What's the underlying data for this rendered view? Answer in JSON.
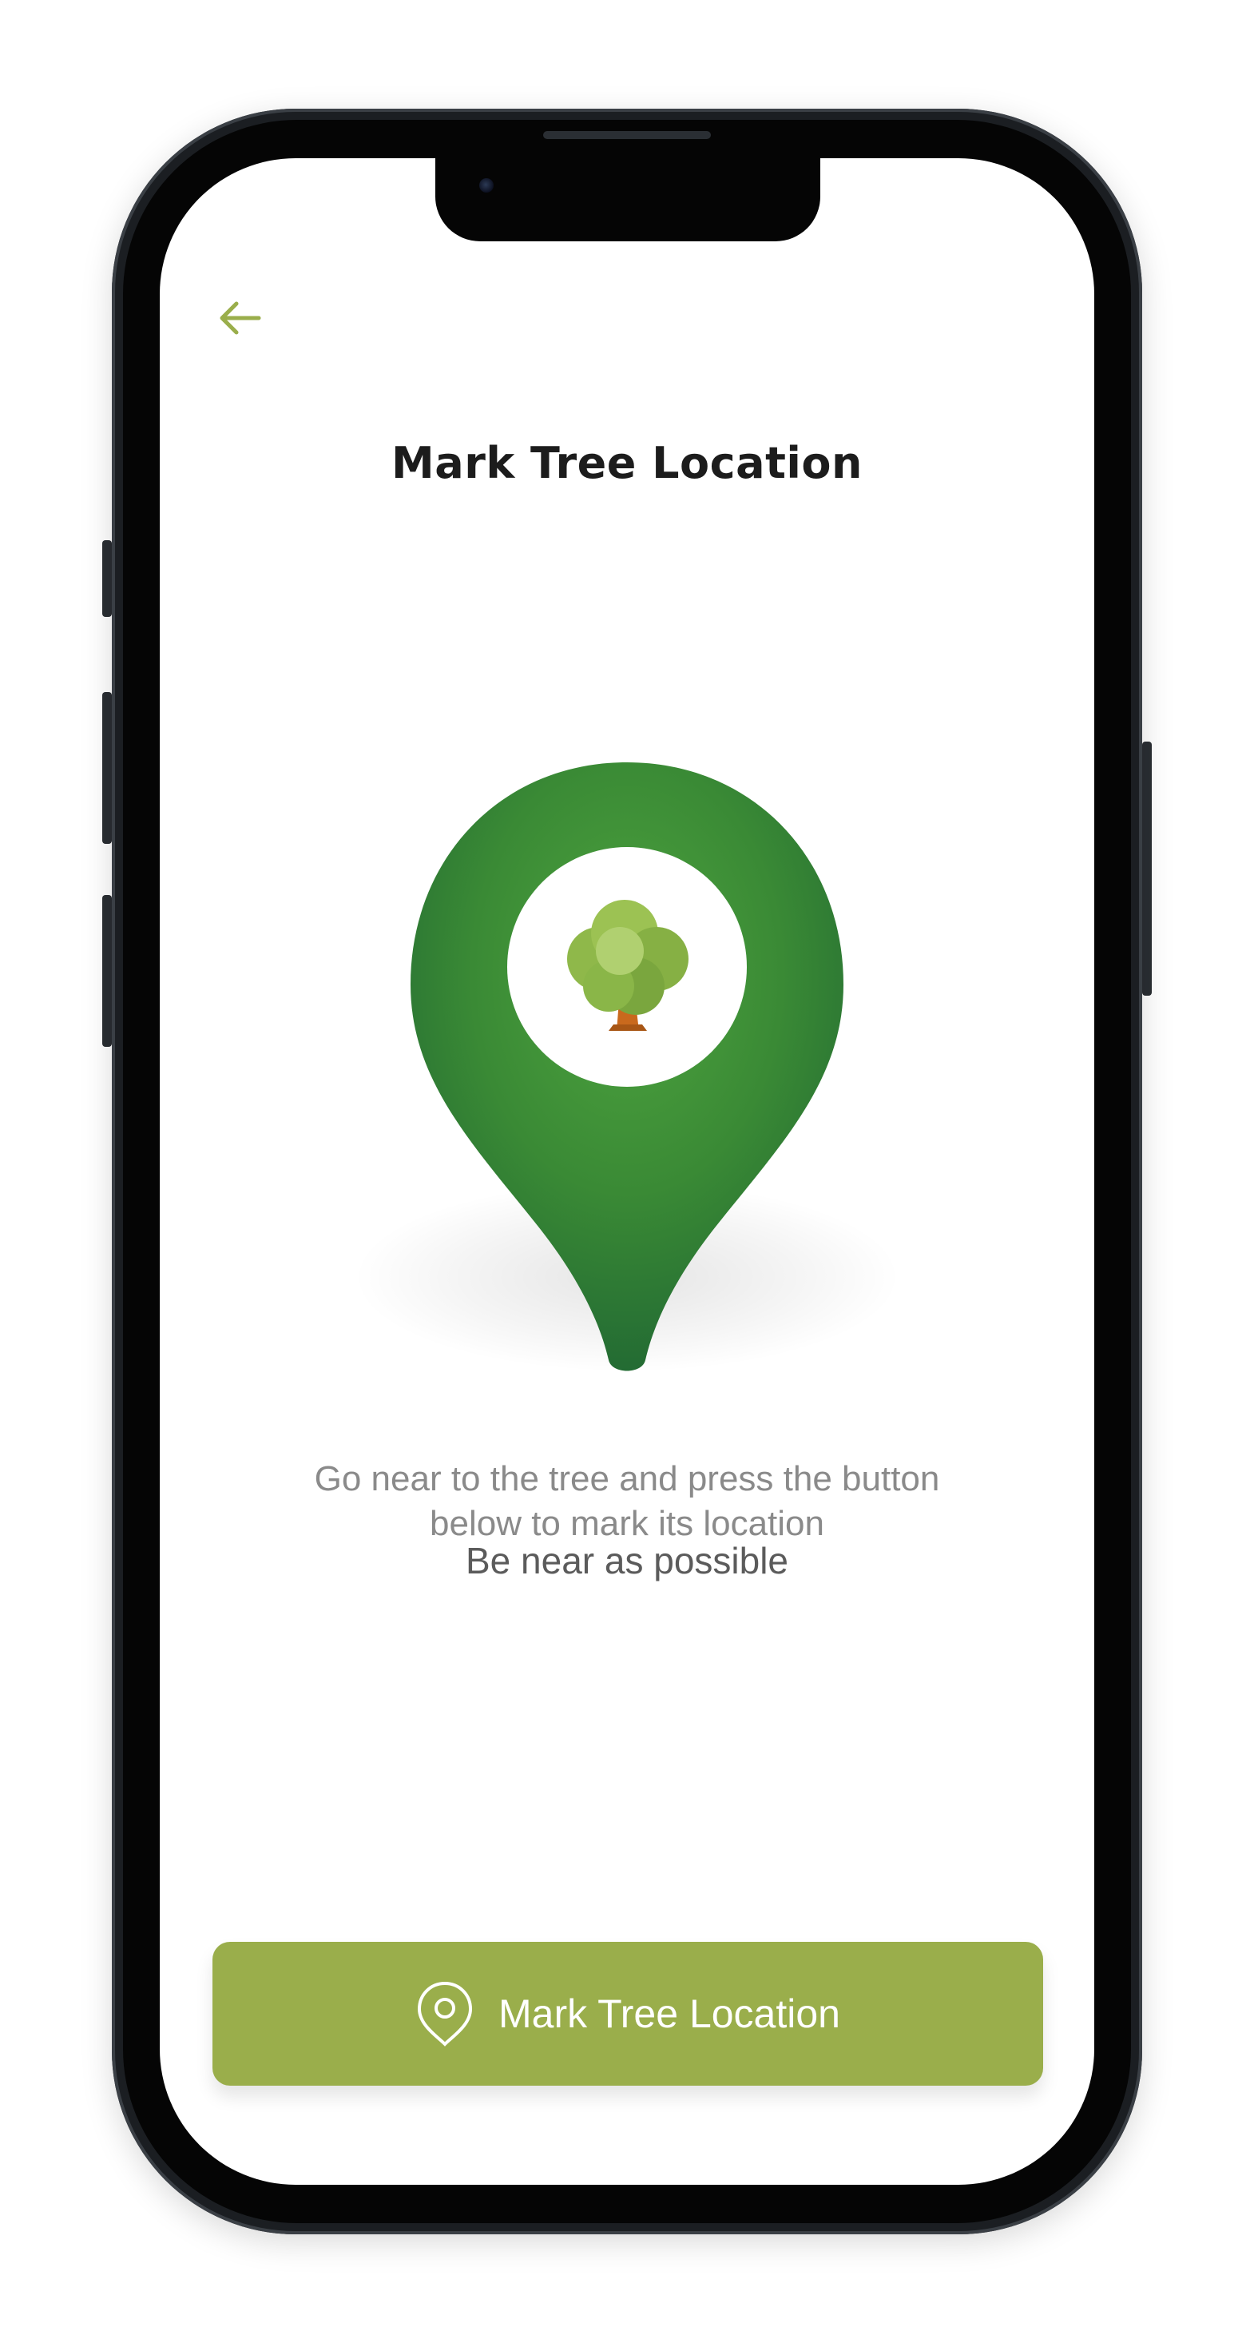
{
  "header": {
    "back_icon": "arrow-left-icon",
    "title": "Mark Tree Location"
  },
  "illustration": {
    "icon": "tree-location-pin-icon",
    "pin_color": "#3a8a35",
    "tree_icon": "tree-icon"
  },
  "instructions": {
    "line1": "Go near to the tree and press the button",
    "line2": "below to mark its location",
    "hint": "Be near as possible"
  },
  "action_button": {
    "icon": "location-pin-icon",
    "label": "Mark Tree Location",
    "color": "#9aae4b"
  },
  "colors": {
    "accent": "#9aae4b",
    "title": "#1c1c1c",
    "body_text": "#8a8a8a"
  }
}
